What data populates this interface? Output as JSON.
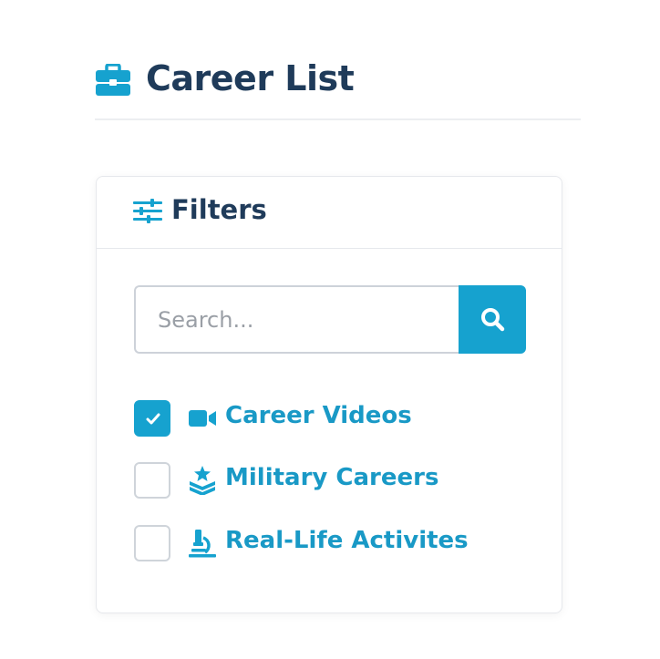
{
  "header": {
    "title": "Career List",
    "icon": "briefcase-icon"
  },
  "filters": {
    "title": "Filters",
    "icon": "sliders-icon",
    "search": {
      "placeholder": "Search...",
      "value": "",
      "button_icon": "search-icon"
    },
    "options": [
      {
        "label": "Career Videos",
        "checked": true,
        "icon": "video-camera-icon"
      },
      {
        "label": "Military Careers",
        "checked": false,
        "icon": "military-rank-icon"
      },
      {
        "label": "Real-Life Activites",
        "checked": false,
        "icon": "microscope-icon"
      }
    ]
  },
  "colors": {
    "accent": "#16a2cf",
    "link": "#1999c6",
    "heading": "#1f3b5a",
    "border": "#cfd4da"
  }
}
